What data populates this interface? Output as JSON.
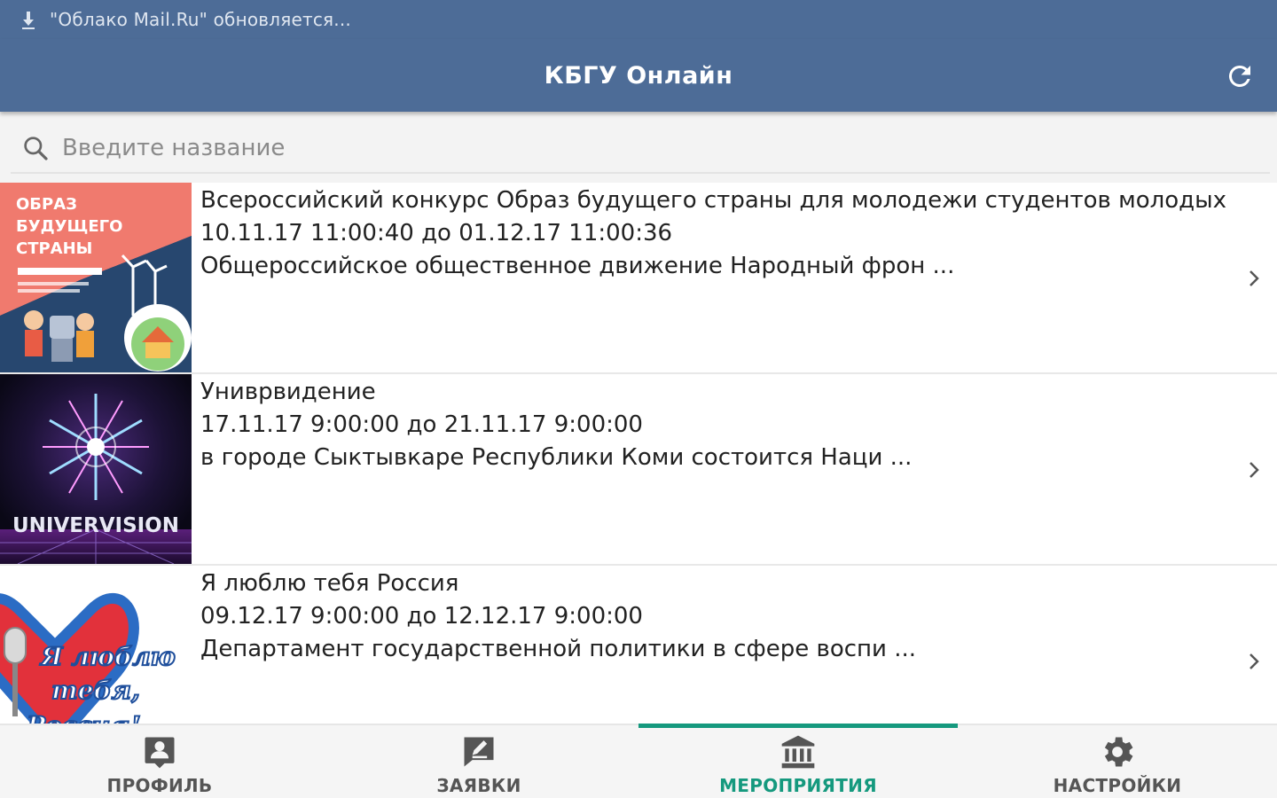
{
  "status_bar": {
    "notification": "\"Облако Mail.Ru\" обновляется..."
  },
  "app_bar": {
    "title": "КБГУ Онлайн"
  },
  "search": {
    "placeholder": "Введите название"
  },
  "events": [
    {
      "title": "Всероссийский конкурс Образ будущего страны для молодежи студентов молодых",
      "dates": "10.11.17 11:00:40 до 01.12.17 11:00:36",
      "description": "Общероссийское общественное движение Народный фрон ...",
      "thumb_text": [
        "ОБРАЗ",
        "БУДУЩЕГО",
        "СТРАНЫ"
      ]
    },
    {
      "title": "Униврвидение",
      "dates": "17.11.17 9:00:00 до 21.11.17 9:00:00",
      "description": "в городе Сыктывкаре Республики Коми состоится Наци ...",
      "thumb_text": [
        "UNIVERVISION"
      ]
    },
    {
      "title": "Я люблю тебя Россия",
      "dates": "09.12.17 9:00:00 до 12.12.17 9:00:00",
      "description": "Департамент государственной политики в сфере воспи ...",
      "thumb_text": [
        "Я люблю",
        "тебя,",
        "Россия!"
      ]
    }
  ],
  "bottom_nav": [
    {
      "label": "ПРОФИЛЬ",
      "icon": "profile-icon"
    },
    {
      "label": "ЗАЯВКИ",
      "icon": "edit-icon"
    },
    {
      "label": "МЕРОПРИЯТИЯ",
      "icon": "institution-icon",
      "active": true
    },
    {
      "label": "НАСТРОЙКИ",
      "icon": "gear-icon"
    }
  ],
  "colors": {
    "primary": "#4d6c97",
    "accent": "#15997e",
    "nav_bg": "#f5f5f5",
    "search_bg": "#f3f3f3"
  }
}
